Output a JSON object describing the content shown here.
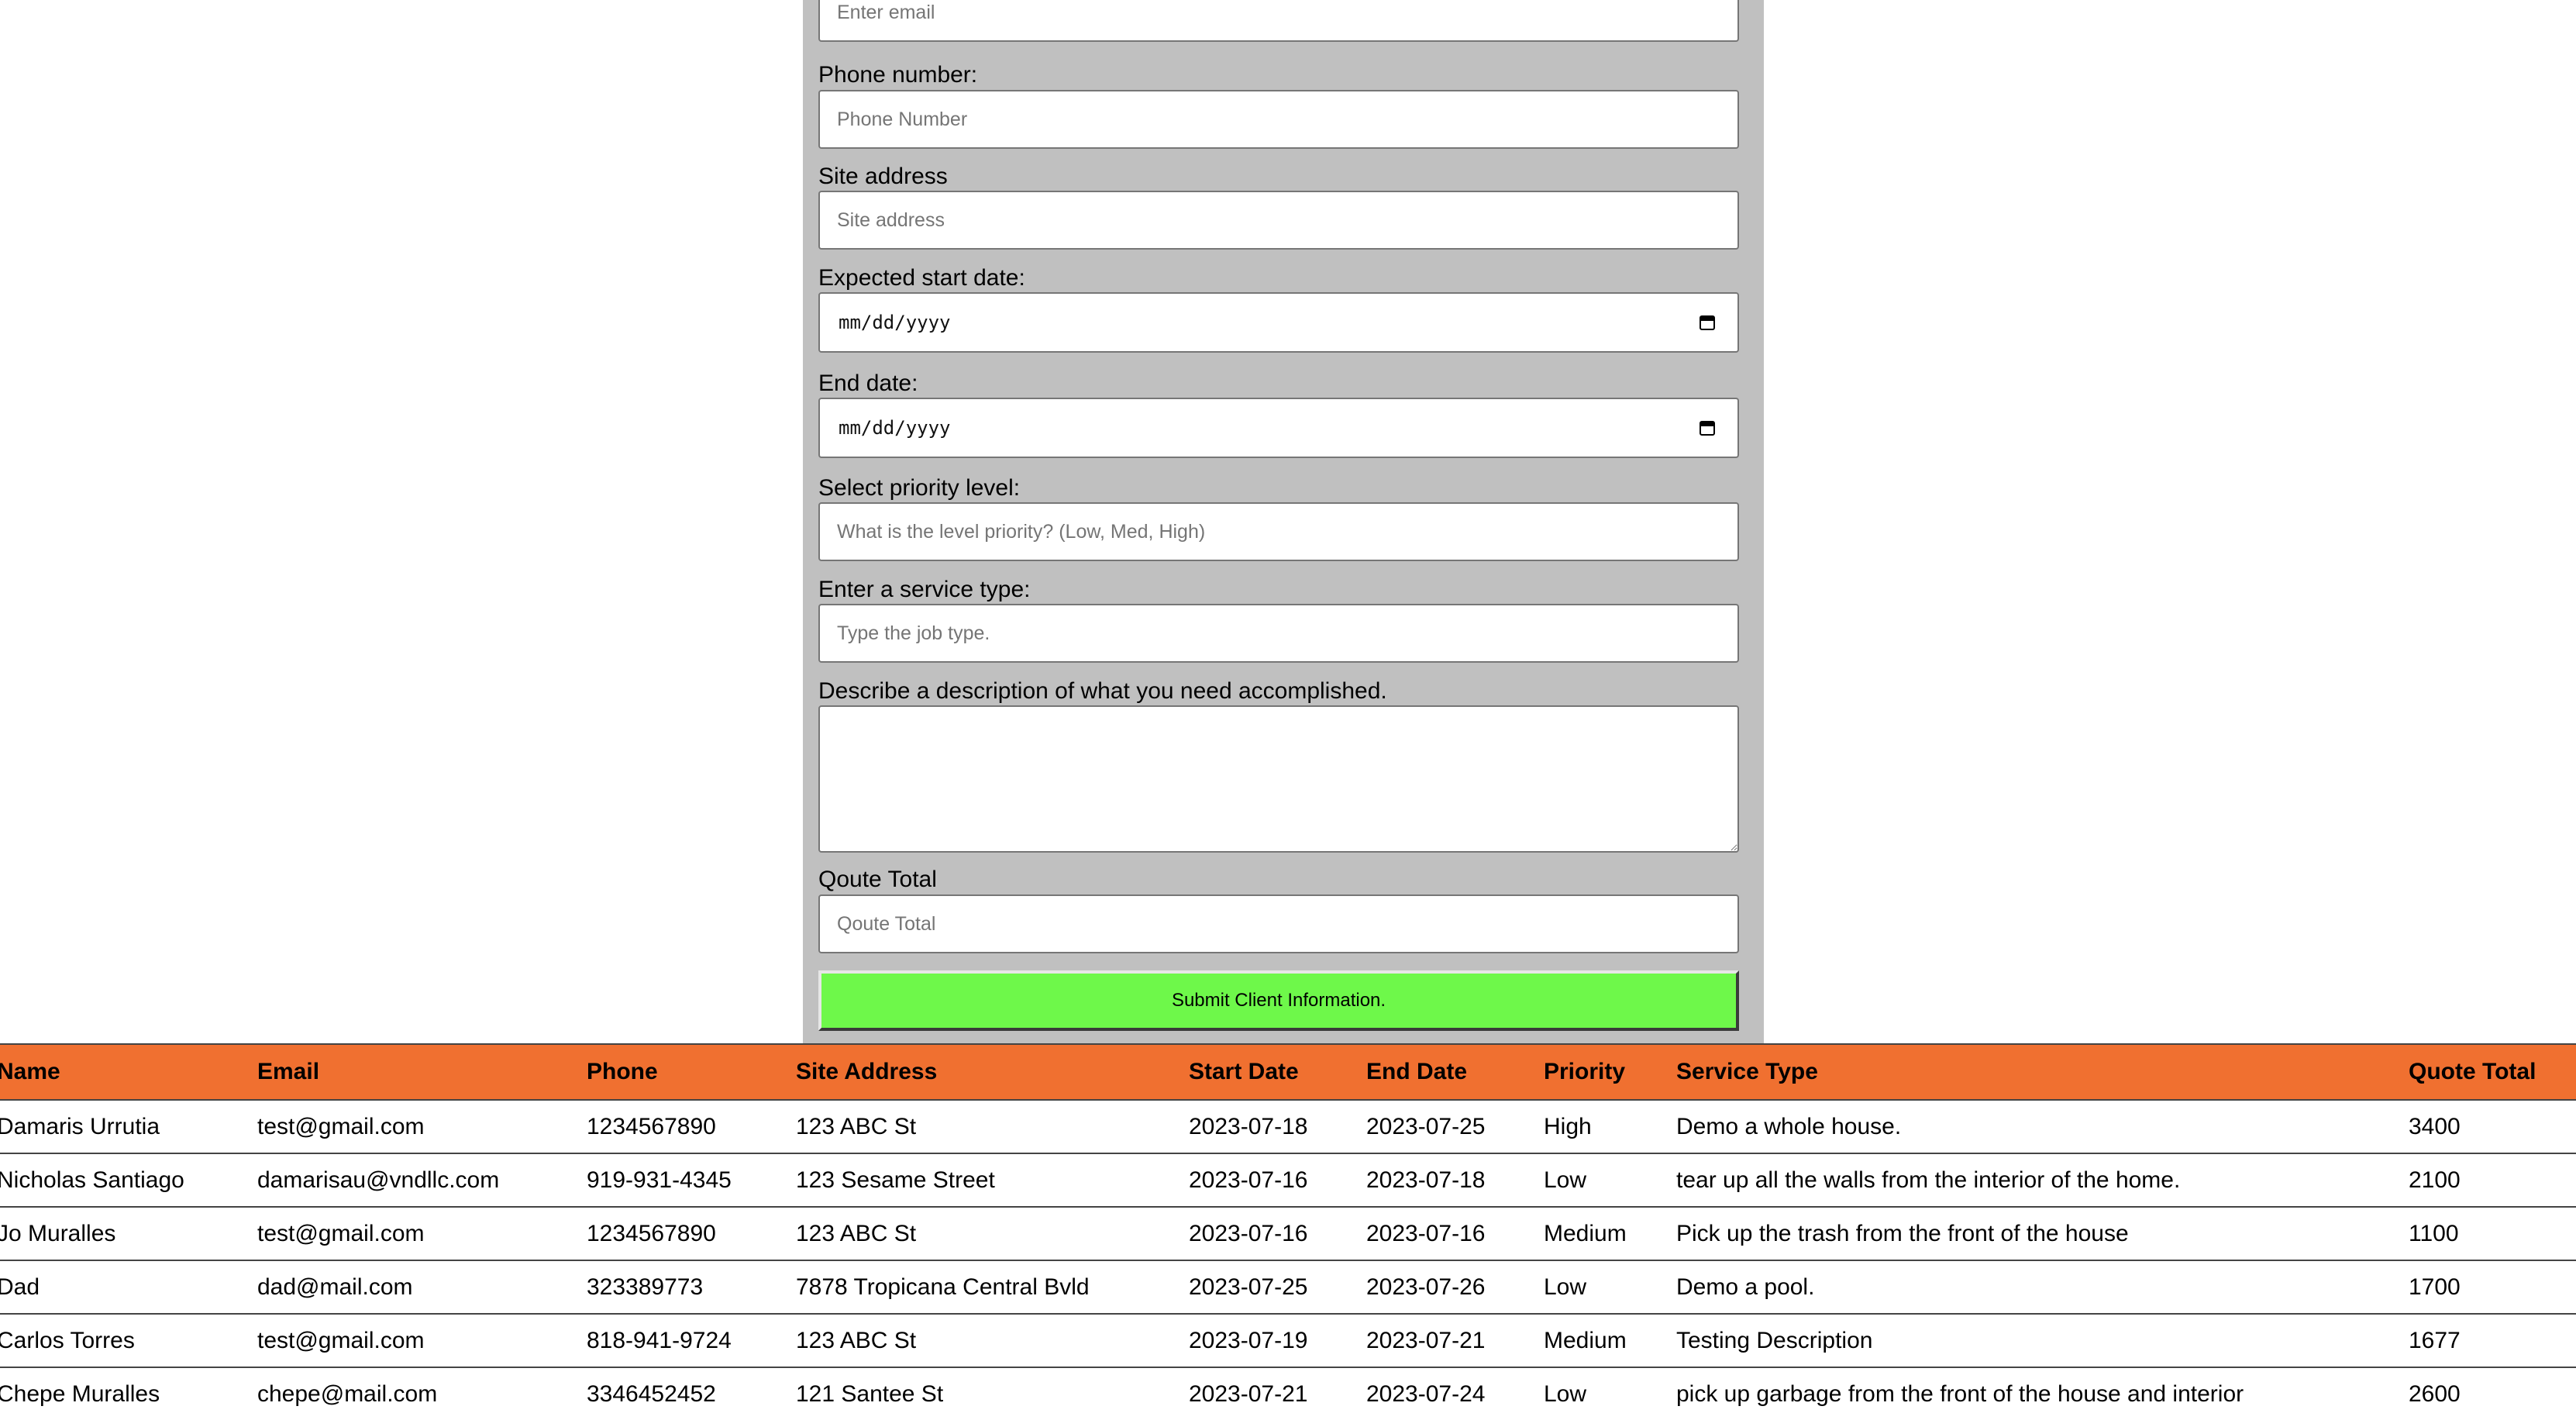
{
  "form": {
    "email": {
      "placeholder": "Enter email"
    },
    "phone": {
      "label": "Phone number:",
      "placeholder": "Phone Number"
    },
    "site_address": {
      "label": "Site address",
      "placeholder": "Site address"
    },
    "start_date": {
      "label": "Expected start date:",
      "value": "mm/dd/yyyy"
    },
    "end_date": {
      "label": "End date:",
      "value": "mm/dd/yyyy"
    },
    "priority": {
      "label": "Select priority level:",
      "placeholder": "What is the level priority? (Low, Med, High)"
    },
    "service_type": {
      "label": "Enter a service type:",
      "placeholder": "Type the job type."
    },
    "description": {
      "label": "Describe a description of what you need accomplished.",
      "value": ""
    },
    "quote_total": {
      "label": "Qoute Total",
      "placeholder": "Qoute Total"
    },
    "submit_label": "Submit Client Information."
  },
  "table": {
    "headers": [
      "Name",
      "Email",
      "Phone",
      "Site Address",
      "Start Date",
      "End Date",
      "Priority",
      "Service Type",
      "Quote Total"
    ],
    "rows": [
      [
        "Damaris Urrutia",
        "test@gmail.com",
        "1234567890",
        "123 ABC St",
        "2023-07-18",
        "2023-07-25",
        "High",
        "Demo a whole house.",
        "3400"
      ],
      [
        "Nicholas Santiago",
        "damarisau@vndllc.com",
        "919-931-4345",
        "123 Sesame Street",
        "2023-07-16",
        "2023-07-18",
        "Low",
        "tear up all the walls from the interior of the home.",
        "2100"
      ],
      [
        "Jo Muralles",
        "test@gmail.com",
        "1234567890",
        "123 ABC St",
        "2023-07-16",
        "2023-07-16",
        "Medium",
        "Pick up the trash from the front of the house",
        "1100"
      ],
      [
        "Dad",
        "dad@mail.com",
        "323389773",
        "7878 Tropicana Central Bvld",
        "2023-07-25",
        "2023-07-26",
        "Low",
        "Demo a pool.",
        "1700"
      ],
      [
        "Carlos Torres",
        "test@gmail.com",
        "818-941-9724",
        "123 ABC St",
        "2023-07-19",
        "2023-07-21",
        "Medium",
        "Testing Description",
        "1677"
      ],
      [
        "Chepe Muralles",
        "chepe@mail.com",
        "3346452452",
        "121 Santee St",
        "2023-07-21",
        "2023-07-24",
        "Low",
        "pick up garbage from the front of the house and interior",
        "2600"
      ]
    ]
  },
  "icons": {
    "date_picker": "calendar-icon"
  },
  "colors": {
    "form_background": "#c0c0c0",
    "submit_button": "#6ef84a",
    "table_header": "#f07030"
  }
}
